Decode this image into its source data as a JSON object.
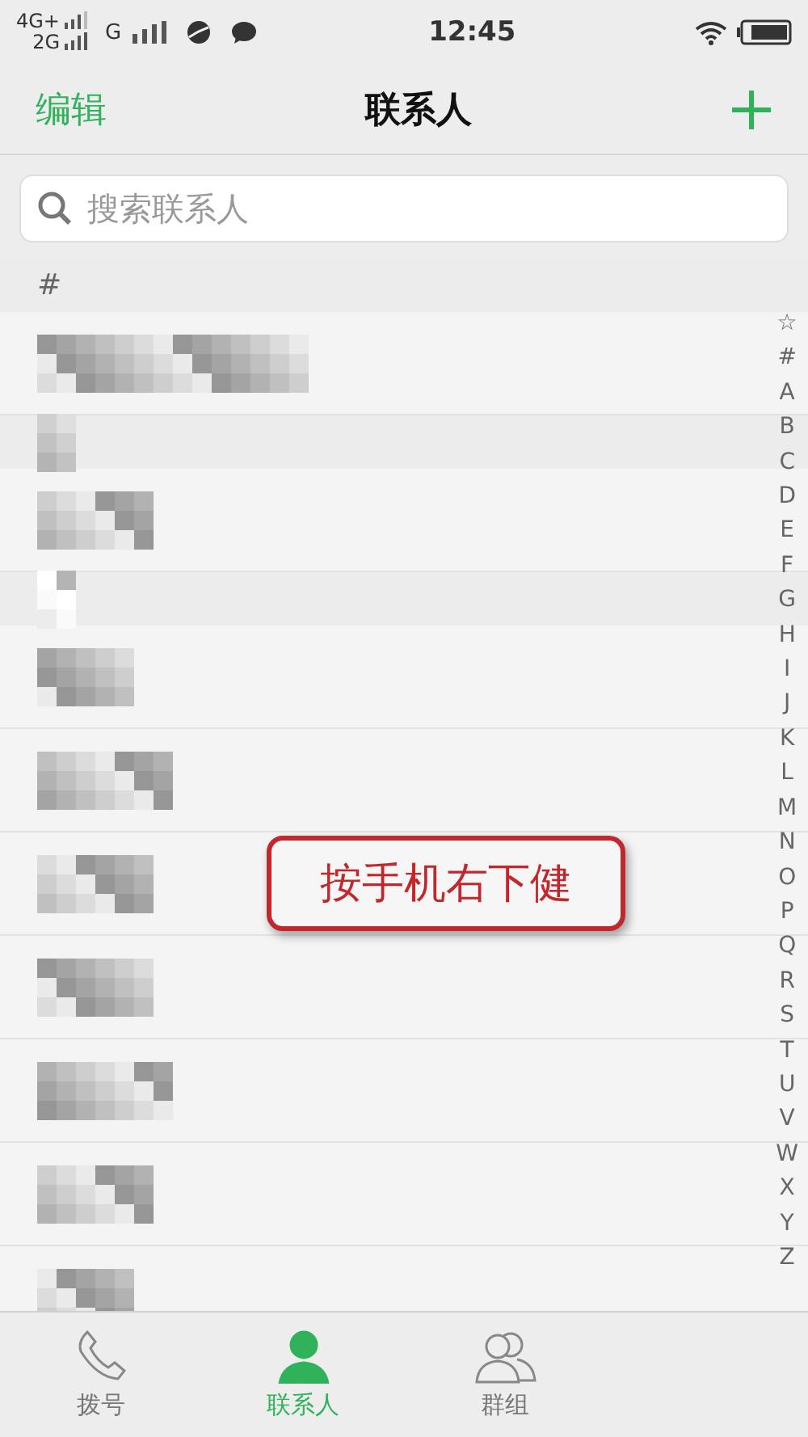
{
  "status_bar": {
    "network_top": "4G+",
    "network_bottom": "2G",
    "network_second": "G",
    "time": "12:45"
  },
  "header": {
    "edit": "编辑",
    "title": "联系人"
  },
  "search": {
    "placeholder": "搜索联系人"
  },
  "first_section": "#",
  "rows": [
    {
      "kind": "contact"
    },
    {
      "kind": "section"
    },
    {
      "kind": "contact"
    },
    {
      "kind": "section"
    },
    {
      "kind": "contact"
    },
    {
      "kind": "contact"
    },
    {
      "kind": "contact"
    },
    {
      "kind": "contact"
    },
    {
      "kind": "contact"
    },
    {
      "kind": "contact"
    },
    {
      "kind": "contact"
    }
  ],
  "index": [
    "☆",
    "#",
    "A",
    "B",
    "C",
    "D",
    "E",
    "F",
    "G",
    "H",
    "I",
    "J",
    "K",
    "L",
    "M",
    "N",
    "O",
    "P",
    "Q",
    "R",
    "S",
    "T",
    "U",
    "V",
    "W",
    "X",
    "Y",
    "Z"
  ],
  "annotation": "按手机右下健",
  "tabs": [
    {
      "label": "拨号",
      "kind": "phone",
      "selected": false
    },
    {
      "label": "联系人",
      "kind": "person",
      "selected": true
    },
    {
      "label": "群组",
      "kind": "group",
      "selected": false
    }
  ]
}
